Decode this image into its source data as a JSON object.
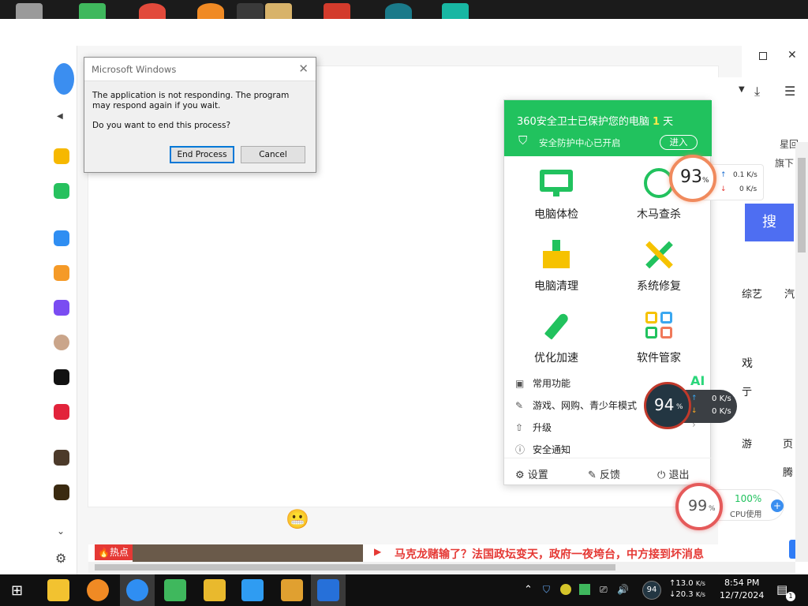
{
  "dialog": {
    "title": "Microsoft Windows",
    "message": "The application is not responding. The program may respond again if you wait.",
    "question": "Do you want to end this process?",
    "end_process_label": "End Process",
    "cancel_label": "Cancel"
  },
  "panel360": {
    "title_prefix": "360安全卫士已保护您的电脑",
    "days": "1",
    "days_unit": "天",
    "subtitle": "安全防护中心已开启",
    "enter_label": "进入",
    "grid": [
      {
        "label": "电脑体检",
        "icon": "monitor-check-icon"
      },
      {
        "label": "木马查杀",
        "icon": "horse-shield-icon"
      },
      {
        "label": "电脑清理",
        "icon": "broom-icon"
      },
      {
        "label": "系统修复",
        "icon": "wrench-icon"
      },
      {
        "label": "优化加速",
        "icon": "rocket-icon"
      },
      {
        "label": "软件管家",
        "icon": "apps-grid-icon"
      }
    ],
    "list": [
      {
        "label": "常用功能",
        "icon": "toolbox-icon"
      },
      {
        "label": "游戏、网购、青少年模式",
        "icon": "tools-icon"
      },
      {
        "label": "升级",
        "icon": "upgrade-arrow-icon"
      },
      {
        "label": "安全通知",
        "icon": "info-icon"
      }
    ],
    "ai_label": "AI",
    "footer": {
      "settings": "设置",
      "feedback": "反馈",
      "exit": "退出"
    }
  },
  "floating_widgets": {
    "w1": {
      "percent": "93",
      "unit": "%",
      "up": "0.1",
      "down": "0",
      "speed_unit": "K/s"
    },
    "w2": {
      "percent": "94",
      "unit": "%",
      "up": "0",
      "down": "0",
      "speed_unit": "K/s"
    },
    "w3": {
      "percent": "99",
      "unit": "%",
      "cpu_percent": "100%",
      "cpu_label": "CPU使用"
    }
  },
  "browser_bg": {
    "right_texts": [
      "星回",
      "旗下",
      "搜",
      "综艺",
      "汽",
      "戏",
      "亍",
      "游",
      "页",
      "腾"
    ],
    "news_tag": "热点",
    "headline": "马克龙赌输了？法国政坛变天，政府一夜垮台，中方接到坏消息"
  },
  "taskbar": {
    "tray_badge": "94",
    "net_up": "13.0",
    "net_down": "20.3",
    "net_unit": "K/s",
    "time": "8:54 PM",
    "date": "12/7/2024",
    "notif_count": "1"
  },
  "colors": {
    "green": "#21c25e",
    "red": "#e53935",
    "dark_circle": "#233642",
    "taskbar": "#101010"
  }
}
